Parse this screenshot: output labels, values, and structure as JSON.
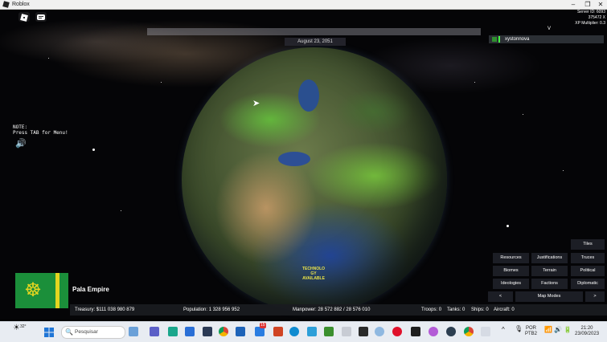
{
  "window": {
    "title": "Roblox"
  },
  "server_info": {
    "line1": "Server ID: 6093",
    "line2": "375472 X",
    "line3": "XP Multiplier: 0.3"
  },
  "game": {
    "date": "August 23, 2051",
    "chevron": "V",
    "player_name": "xystonnova",
    "note_line1": "NOTE:",
    "note_line2": "Press TAB for Menu!",
    "tech_text": "TECHNOLO\nGY\nAVAILABLE"
  },
  "side_panel": {
    "tiles": "Tiles",
    "resources": "Resources",
    "justifications": "Justifications",
    "truces": "Truces",
    "biomes": "Biomes",
    "terrain": "Terrain",
    "political": "Political",
    "ideologies": "Ideologies",
    "factions": "Factions",
    "diplomatic": "Diplomatic",
    "prev": "<",
    "map_modes": "Map Modes",
    "next": ">"
  },
  "country": {
    "name": "Pala Empire",
    "flag_colors": [
      "#1b8f3a",
      "#e4d520"
    ]
  },
  "stats": {
    "treasury": "Treasury:  $111 038 980 879",
    "population": "Population: 1 328 956 952",
    "manpower": "Manpower:  28 572 882  /  28 576 010",
    "troops": "Troops: 0",
    "tanks": "Tanks: 0",
    "ships": "Ships: 0",
    "aircraft": "Aircraft: 0"
  },
  "taskbar": {
    "weather": "32°",
    "search_placeholder": "Pesquisar",
    "badge": "15",
    "lang1": "POR",
    "lang2": "PTB2",
    "time": "21:20",
    "date": "23/09/2023"
  },
  "colors": {
    "accent_green": "#1b8f3a",
    "flag_yellow": "#e4d520",
    "tech_yellow": "#e9e24a"
  }
}
